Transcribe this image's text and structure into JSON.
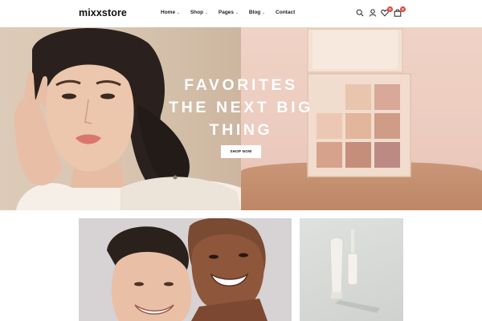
{
  "header": {
    "logo": "mixxstore",
    "nav": [
      {
        "label": "Home",
        "has_dropdown": true
      },
      {
        "label": "Shop",
        "has_dropdown": true
      },
      {
        "label": "Pages",
        "has_dropdown": true
      },
      {
        "label": "Blog",
        "has_dropdown": true
      },
      {
        "label": "Contact",
        "has_dropdown": false
      }
    ],
    "icons": [
      {
        "name": "search-icon"
      },
      {
        "name": "account-icon"
      },
      {
        "name": "wishlist-icon",
        "badge": "0"
      },
      {
        "name": "cart-icon",
        "badge": "0"
      }
    ],
    "badge_color": "#e0483f"
  },
  "hero": {
    "title_lines": [
      "FAVORITES",
      "THE NEXT BIG",
      "THING"
    ],
    "button_label": "SHOP NOW"
  },
  "colors": {
    "hero_left_bg": "#d9c6b1",
    "hero_right_bg": "#ecccbf",
    "palette_case": "#eed8c8"
  }
}
